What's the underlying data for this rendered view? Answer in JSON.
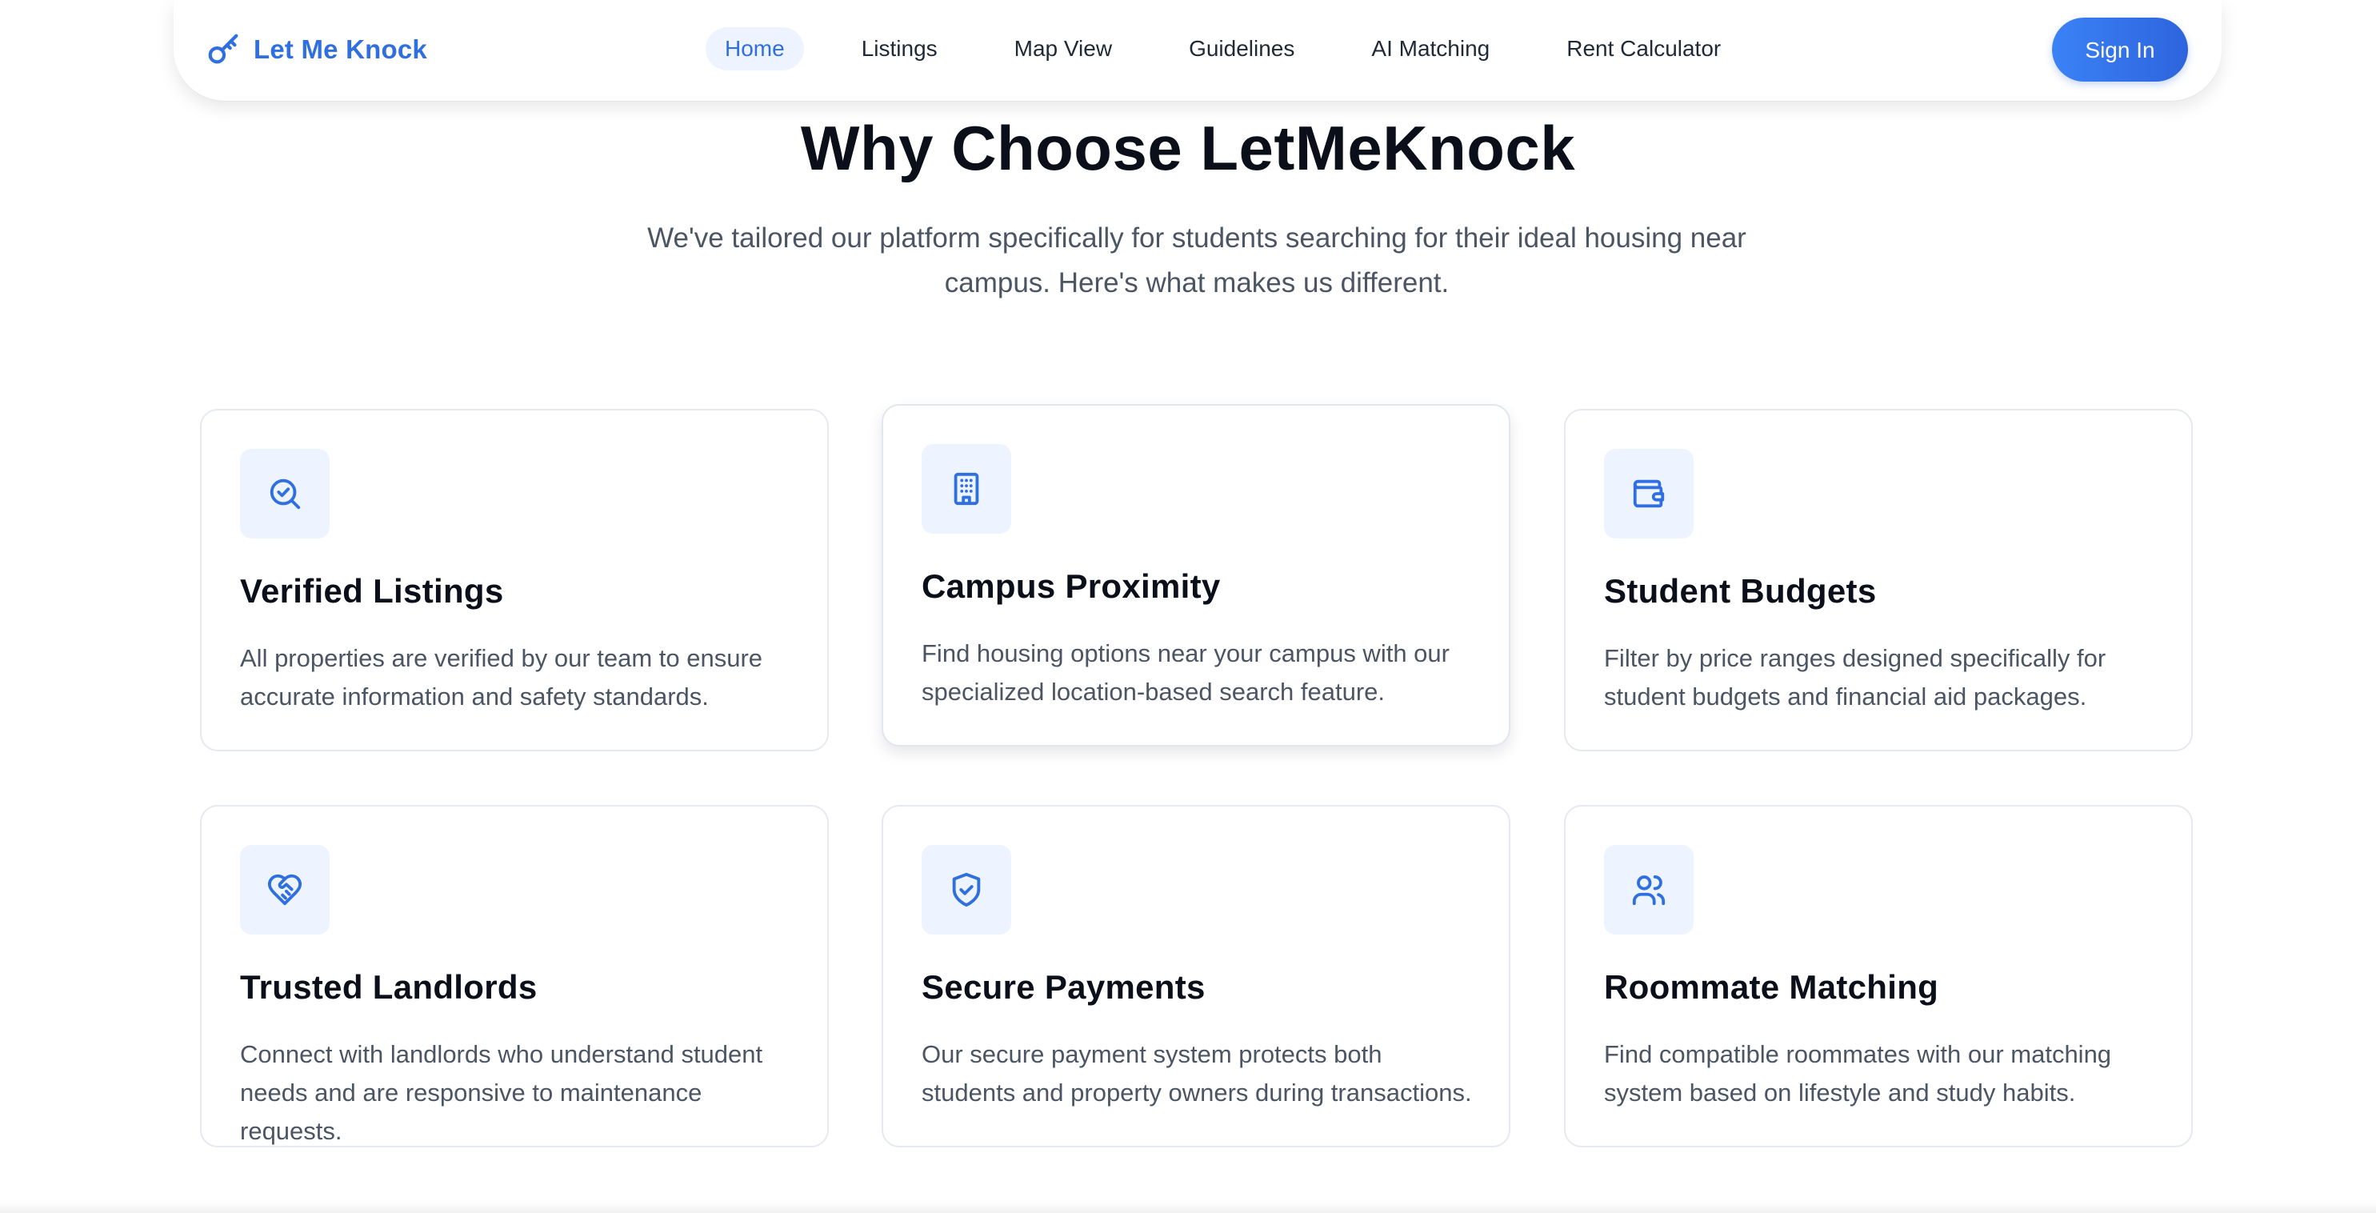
{
  "brand": {
    "name": "Let Me Knock",
    "icon": "key-icon",
    "color": "#2f6fe0"
  },
  "nav": {
    "items": [
      {
        "label": "Home",
        "active": true
      },
      {
        "label": "Listings"
      },
      {
        "label": "Map View"
      },
      {
        "label": "Guidelines"
      },
      {
        "label": "AI Matching"
      },
      {
        "label": "Rent Calculator"
      }
    ],
    "signin_label": "Sign In"
  },
  "section": {
    "title": "Why Choose LetMeKnock",
    "subtitle": "We've tailored our platform specifically for students searching for their ideal housing near campus. Here's what makes us different."
  },
  "features": [
    {
      "icon": "search-check-icon",
      "title": "Verified Listings",
      "description": "All properties are verified by our team to ensure accurate information and safety standards."
    },
    {
      "icon": "building-icon",
      "title": "Campus Proximity",
      "description": "Find housing options near your campus with our specialized location-based search feature."
    },
    {
      "icon": "wallet-icon",
      "title": "Student Budgets",
      "description": "Filter by price ranges designed specifically for student budgets and financial aid packages."
    },
    {
      "icon": "heart-handshake-icon",
      "title": "Trusted Landlords",
      "description": "Connect with landlords who understand student needs and are responsive to maintenance requests."
    },
    {
      "icon": "shield-check-icon",
      "title": "Secure Payments",
      "description": "Our secure payment system protects both students and property owners during transactions."
    },
    {
      "icon": "users-icon",
      "title": "Roommate Matching",
      "description": "Find compatible roommates with our matching system based on lifestyle and study habits."
    }
  ],
  "colors": {
    "accent": "#2f6fe0",
    "icon_bg": "#eef4ff",
    "heading": "#0b0f19",
    "body_text": "#4b5563"
  }
}
